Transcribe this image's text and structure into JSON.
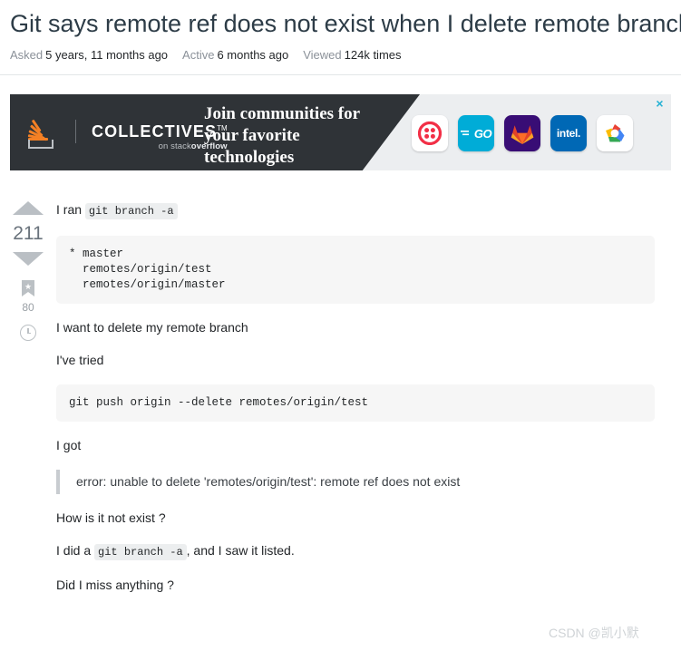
{
  "question": {
    "title": "Git says remote ref does not exist when I delete remote branch",
    "meta": [
      {
        "label": "Asked",
        "value": "5 years, 11 months ago"
      },
      {
        "label": "Active",
        "value": "6 months ago"
      },
      {
        "label": "Viewed",
        "value": "124k times"
      }
    ],
    "votes": "211",
    "bookmark_count": "80"
  },
  "ad": {
    "brand": "COLLECTIVES",
    "trademark": "TM",
    "sub_prefix": "on stack",
    "sub_bold": "overflow",
    "headline": "Join communities for your favorite technologies",
    "close_label": "×",
    "tiles": [
      {
        "name": "twilio",
        "label": ""
      },
      {
        "name": "go",
        "label": "GO"
      },
      {
        "name": "gitlab",
        "label": ""
      },
      {
        "name": "intel",
        "label": "intel."
      },
      {
        "name": "google-cloud",
        "label": ""
      }
    ]
  },
  "post": {
    "line_ran_prefix": "I ran",
    "code_ran": "git branch -a",
    "code_block_branches": "* master\n  remotes/origin/test\n  remotes/origin/master",
    "line_want": "I want to delete my remote branch",
    "line_tried": "I've tried",
    "code_block_push": "git push origin --delete remotes/origin/test",
    "line_got": "I got",
    "quote_error": "error: unable to delete 'remotes/origin/test': remote ref does not exist",
    "line_how": "How is it not exist ?",
    "line_did_prefix": "I did a",
    "code_did": "git branch -a",
    "line_did_suffix": ", and I saw it listed.",
    "line_miss": "Did I miss anything ?"
  },
  "watermark": "CSDN @凯小默",
  "colors": {
    "title": "#2d3c47",
    "accent_orange": "#f48024",
    "ad_dark": "#2f3337",
    "code_bg": "#f6f6f6"
  }
}
